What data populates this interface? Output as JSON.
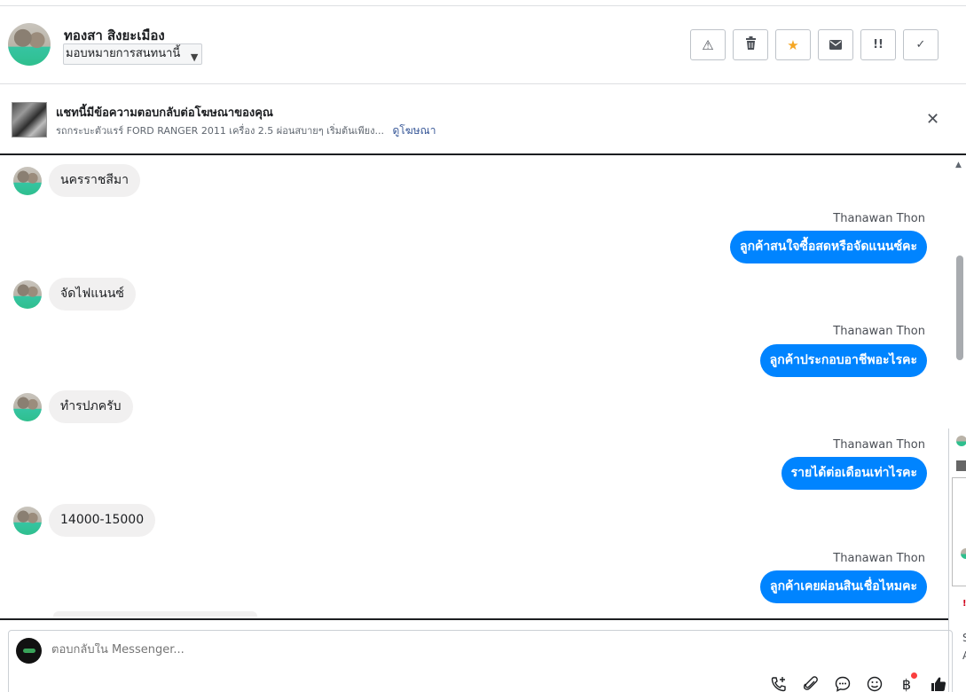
{
  "header": {
    "contact_name": "ทองสา สิงยะเมือง",
    "assign_label": "มอบหมายการสนทนานี้",
    "actions": [
      {
        "name": "report-spam-button",
        "icon": "warning-icon",
        "glyph": "⚠"
      },
      {
        "name": "delete-button",
        "icon": "trash-icon",
        "glyph": "🗑"
      },
      {
        "name": "star-button",
        "icon": "star-icon",
        "glyph": "★"
      },
      {
        "name": "mark-unread-button",
        "icon": "envelope-icon",
        "glyph": "✉"
      },
      {
        "name": "follow-up-button",
        "icon": "exclamation-icon",
        "glyph": "!!"
      },
      {
        "name": "mark-done-button",
        "icon": "check-icon",
        "glyph": "✓"
      }
    ]
  },
  "banner": {
    "title": "แชทนี้มีข้อความตอบกลับต่อโฆษณาของคุณ",
    "subtitle": "รถกระบะตัวแรร์ FORD RANGER 2011 เครื่อง 2.5 ผ่อนสบายๆ เริ่มต้นเพียง...",
    "link": "ดูโฆษณา",
    "close": "✕"
  },
  "messages": {
    "incoming": [
      {
        "text": "นครราชสีมา"
      },
      {
        "text": "จัดไฟแนนซ์"
      },
      {
        "text": "ทำรปภครับ"
      },
      {
        "text": "14000-15000"
      }
    ],
    "outgoing": [
      {
        "sender": "Thanawan Thon",
        "text": "ลูกค้าสนใจซื้อสดหรือจัดแนนซ์คะ"
      },
      {
        "sender": "Thanawan Thon",
        "text": "ลูกค้าประกอบอาชีพอะไรคะ"
      },
      {
        "sender": "Thanawan Thon",
        "text": "รายได้ต่อเดือนเท่าไรคะ"
      },
      {
        "sender": "Thanawan Thon",
        "text": "ลูกค้าเคยผ่อนสินเชื่อไหมคะ"
      }
    ]
  },
  "composer": {
    "placeholder": "ตอบกลับใน Messenger...",
    "tools": [
      {
        "name": "call-icon",
        "glyph": "📞"
      },
      {
        "name": "attachment-icon",
        "glyph": "📎"
      },
      {
        "name": "saved-reply-icon",
        "glyph": "💬"
      },
      {
        "name": "emoji-icon",
        "glyph": "☺"
      },
      {
        "name": "payment-icon",
        "glyph": "฿"
      },
      {
        "name": "like-icon",
        "glyph": "👍"
      }
    ]
  },
  "side_overlay": {
    "red_mark": "!",
    "text_1": "S",
    "text_2": "A"
  },
  "colors": {
    "outgoing_bubble": "#0084ff",
    "incoming_bubble": "#f1f0f0",
    "star": "#f5a623",
    "link": "#385898"
  }
}
